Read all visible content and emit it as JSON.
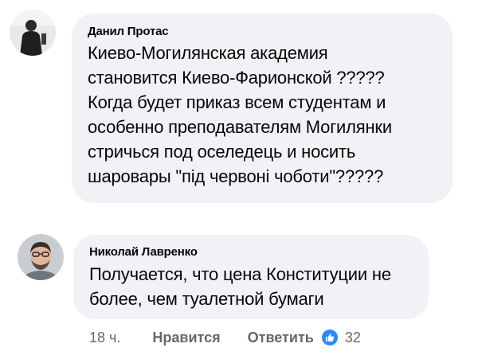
{
  "comments": [
    {
      "author": "Данил Протас",
      "text_lines": [
        "Киево-Могилянская академия",
        "становится Киево-Фарионской ?????",
        "Когда будет приказ всем студентам и",
        "особенно преподавателям Могилянки",
        "стричься под оселедець и носить",
        "шаровары \"під червоні чоботи\"?????"
      ],
      "avatar_icon": "person-silhouette-avatar"
    },
    {
      "author": "Николай Лавренко",
      "text_lines": [
        "Получается, что цена Конституции не",
        "более, чем туалетной бумаги"
      ],
      "avatar_icon": "man-with-glasses-avatar"
    }
  ],
  "meta": {
    "time": "18 ч.",
    "like_label": "Нравится",
    "reply_label": "Ответить",
    "reaction_icon": "thumbs-up-icon",
    "reaction_count": "32"
  },
  "colors": {
    "bubble": "#f0f2f5",
    "text": "#050505",
    "meta": "#65676b",
    "like_badge": "#2d88ff"
  }
}
